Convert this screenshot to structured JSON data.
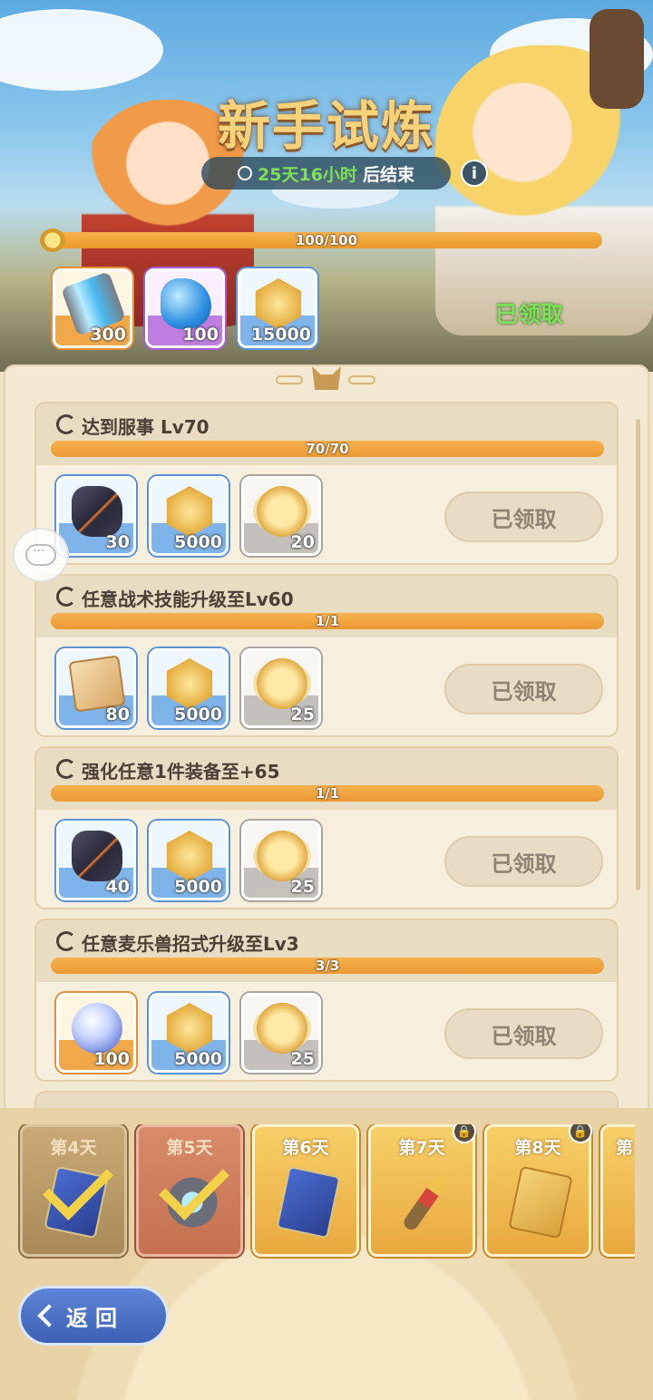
{
  "header": {
    "title": "新手试炼",
    "timer_value": "25天16小时",
    "timer_suffix": "后结束",
    "info_label": "i",
    "progress_text": "100/100",
    "progress": 1.0,
    "rewards": [
      {
        "icon": "energy-canister-icon",
        "qty": "300",
        "rarity": "orange"
      },
      {
        "icon": "blue-gem-icon",
        "qty": "100",
        "rarity": "purple"
      },
      {
        "icon": "gold-coin-icon",
        "qty": "15000",
        "rarity": "blue"
      }
    ],
    "claimed_label": "已领取"
  },
  "tasks": [
    {
      "name": "达到服事  Lv70",
      "progress_text": "70/70",
      "progress": 1.0,
      "button": "已领取",
      "rewards": [
        {
          "icon": "ore-icon",
          "qty": "30",
          "rarity": "blue"
        },
        {
          "icon": "gold-coin-icon",
          "qty": "5000",
          "rarity": "blue"
        },
        {
          "icon": "winged-coin-icon",
          "qty": "20",
          "rarity": "grey"
        }
      ]
    },
    {
      "name": "任意战术技能升级至Lv60",
      "progress_text": "1/1",
      "progress": 1.0,
      "button": "已领取",
      "rewards": [
        {
          "icon": "skill-card-icon",
          "qty": "80",
          "rarity": "blue"
        },
        {
          "icon": "gold-coin-icon",
          "qty": "5000",
          "rarity": "blue"
        },
        {
          "icon": "winged-coin-icon",
          "qty": "25",
          "rarity": "grey"
        }
      ]
    },
    {
      "name": "强化任意1件装备至+65",
      "progress_text": "1/1",
      "progress": 1.0,
      "button": "已领取",
      "rewards": [
        {
          "icon": "ore-icon",
          "qty": "40",
          "rarity": "blue"
        },
        {
          "icon": "gold-coin-icon",
          "qty": "5000",
          "rarity": "blue"
        },
        {
          "icon": "winged-coin-icon",
          "qty": "25",
          "rarity": "grey"
        }
      ]
    },
    {
      "name": "任意麦乐兽招式升级至Lv3",
      "progress_text": "3/3",
      "progress": 1.0,
      "button": "已领取",
      "rewards": [
        {
          "icon": "crystal-orb-icon",
          "qty": "100",
          "rarity": "orange"
        },
        {
          "icon": "gold-coin-icon",
          "qty": "5000",
          "rarity": "blue"
        },
        {
          "icon": "winged-coin-icon",
          "qty": "25",
          "rarity": "grey"
        }
      ]
    }
  ],
  "days": [
    {
      "label": "第4天",
      "state": "done",
      "icon": "card-blue-icon",
      "locked": false
    },
    {
      "label": "第5天",
      "state": "current",
      "icon": "gear-icon",
      "locked": false
    },
    {
      "label": "第6天",
      "state": "available",
      "icon": "card-blue-icon",
      "locked": false
    },
    {
      "label": "第7天",
      "state": "available",
      "icon": "wand-icon",
      "locked": true
    },
    {
      "label": "第8天",
      "state": "available",
      "icon": "card-gold-icon",
      "locked": true
    },
    {
      "label": "第",
      "state": "available",
      "icon": "figure-icon",
      "locked": false
    }
  ],
  "back_button": {
    "label": "返回"
  },
  "colors": {
    "accent_orange": "#eb9a35",
    "claimed_green": "#7ee05a",
    "back_blue": "#3d60b3"
  }
}
